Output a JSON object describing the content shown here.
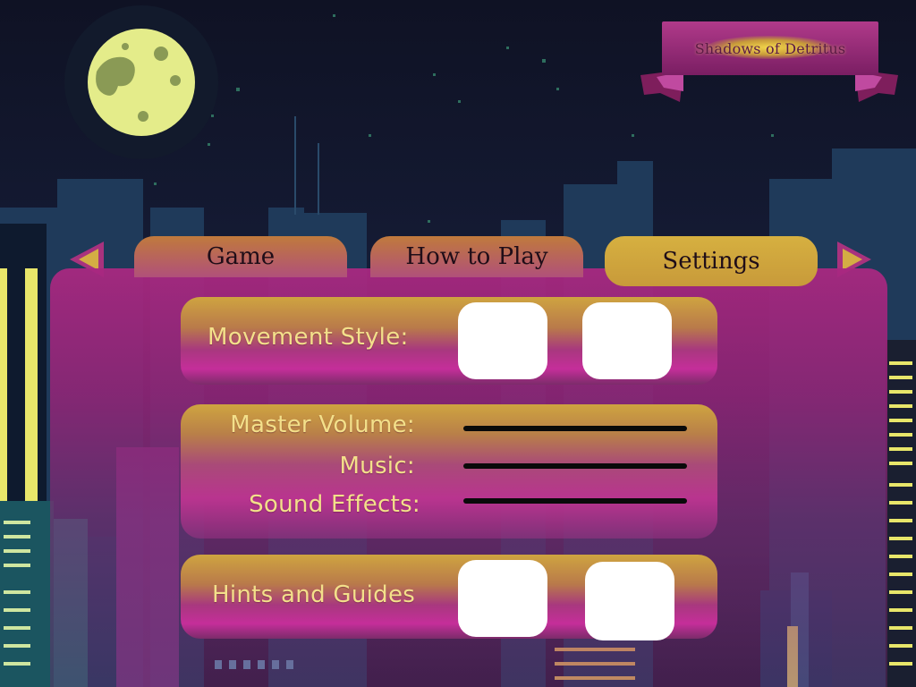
{
  "game_title": "Shadows of Detritus",
  "nav": {
    "prev_arrow": "left-arrow-icon",
    "next_arrow": "right-arrow-icon"
  },
  "tabs": [
    {
      "label": "Game",
      "active": false
    },
    {
      "label": "How to Play",
      "active": false
    },
    {
      "label": "Settings",
      "active": true
    }
  ],
  "settings": {
    "movement_style_label": "Movement Style:",
    "master_volume_label": "Master Volume:",
    "music_label": "Music:",
    "sound_effects_label": "Sound Effects:",
    "hints_label": "Hints and Guides"
  },
  "colors": {
    "panel": "#a82880",
    "tab_inactive": "#c07a3c",
    "tab_active": "#d6b040",
    "label_text": "#f3e08a",
    "moon": "#e4ec8a"
  }
}
